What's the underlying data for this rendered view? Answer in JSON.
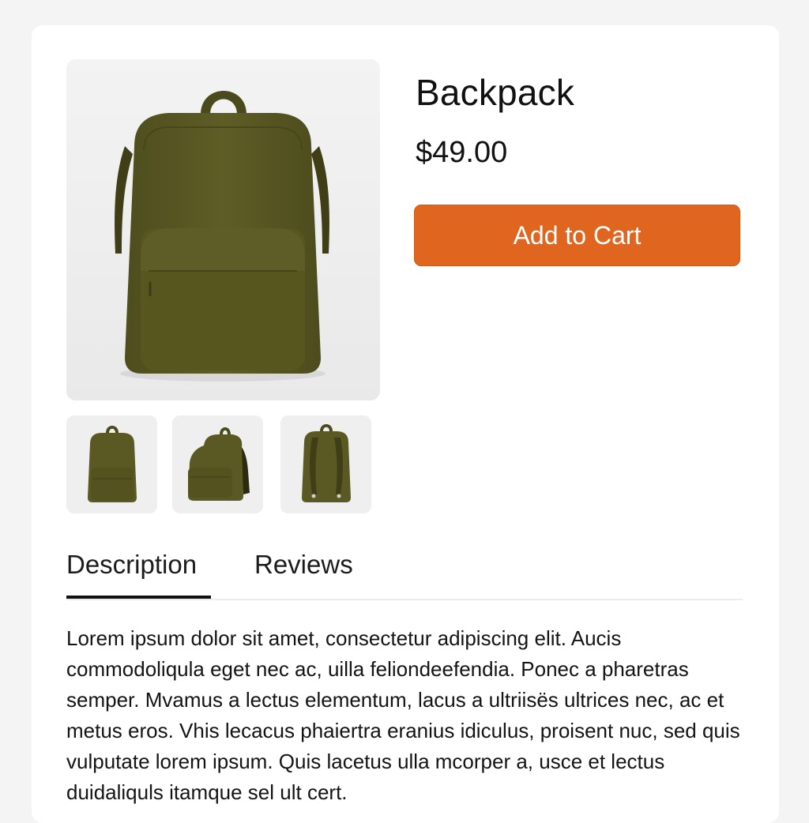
{
  "product": {
    "title": "Backpack",
    "price": "$49.00",
    "add_to_cart_label": "Add to Cart"
  },
  "gallery": {
    "main_image": "backpack-front-photo",
    "thumbnails": [
      "backpack-front",
      "backpack-angled",
      "backpack-back"
    ]
  },
  "tabs": [
    {
      "label": "Description",
      "active": true
    },
    {
      "label": "Reviews",
      "active": false
    }
  ],
  "description": {
    "text": "Lorem ipsum dolor sit amet, consectetur adipiscing elit. Aucis commodoliqula eget nec ac, uilla feliondeefendia. Ponec a pharetras semper. Mvamus a lectus elementum, lacus a ultriisës ultrices nec, ac et metus eros. Vhis lecacus phaiertra eranius idiculus, proisent nuc, sed quis vulputate lorem ipsum. Quis lacetus ulla mcorper a, usce et  lectus duidaliquls itamque sel ult cert."
  },
  "colors": {
    "accent": "#e0661f",
    "backpack": "#5b5a24"
  }
}
